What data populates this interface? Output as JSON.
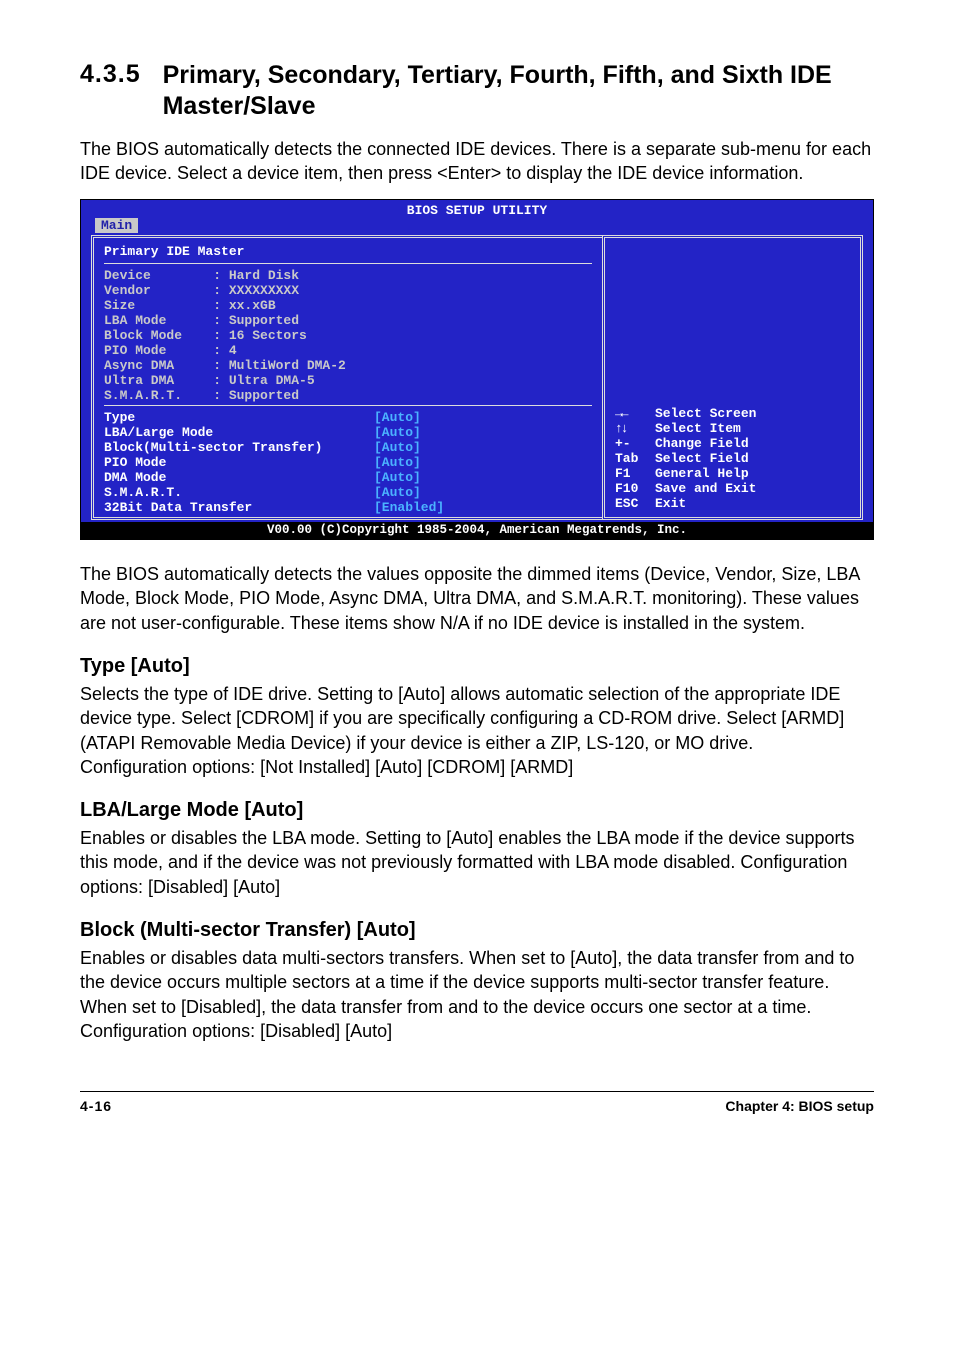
{
  "section": {
    "number": "4.3.5",
    "title": "Primary, Secondary, Tertiary, Fourth, Fifth, and Sixth IDE Master/Slave"
  },
  "intro": "The BIOS automatically detects the connected IDE devices. There is a separate sub-menu for each IDE device. Select a device item, then press <Enter> to display the IDE device information.",
  "bios": {
    "title": "BIOS SETUP UTILITY",
    "tab": "Main",
    "panel_head": "Primary IDE Master",
    "detected": [
      {
        "k": "Device",
        "v": "Hard Disk"
      },
      {
        "k": "Vendor",
        "v": "XXXXXXXXX"
      },
      {
        "k": "Size",
        "v": "xx.xGB"
      },
      {
        "k": "LBA Mode",
        "v": "Supported"
      },
      {
        "k": "Block Mode",
        "v": "16 Sectors"
      },
      {
        "k": "PIO Mode",
        "v": "4"
      },
      {
        "k": "Async DMA",
        "v": "MultiWord DMA-2"
      },
      {
        "k": "Ultra DMA",
        "v": "Ultra DMA-5"
      },
      {
        "k": "S.M.A.R.T.",
        "v": "Supported"
      }
    ],
    "config": [
      {
        "k": "Type",
        "v": "[Auto]"
      },
      {
        "k": "LBA/Large Mode",
        "v": "[Auto]"
      },
      {
        "k": "Block(Multi-sector Transfer)",
        "v": "[Auto]"
      },
      {
        "k": "PIO Mode",
        "v": "[Auto]"
      },
      {
        "k": "DMA Mode",
        "v": "[Auto]"
      },
      {
        "k": "S.M.A.R.T.",
        "v": "[Auto]"
      },
      {
        "k": "32Bit Data Transfer",
        "v": "[Enabled]"
      }
    ],
    "help": [
      {
        "key_icon": "lr",
        "key": "",
        "lbl": "Select Screen"
      },
      {
        "key_icon": "ud",
        "key": "",
        "lbl": "Select Item"
      },
      {
        "key": "+-",
        "lbl": "Change Field"
      },
      {
        "key": "Tab",
        "lbl": "Select Field"
      },
      {
        "key": "F1",
        "lbl": "General Help"
      },
      {
        "key": "F10",
        "lbl": "Save and Exit"
      },
      {
        "key": "ESC",
        "lbl": "Exit"
      }
    ],
    "footer": "V00.00 (C)Copyright 1985-2004, American Megatrends, Inc."
  },
  "post_bios_para": "The BIOS automatically detects the values opposite the dimmed items (Device, Vendor, Size, LBA Mode, Block Mode, PIO Mode, Async DMA, Ultra DMA, and S.M.A.R.T. monitoring). These values are not user-configurable. These items show N/A if no IDE device is installed in the system.",
  "subsections": [
    {
      "title": "Type [Auto]",
      "body": "Selects the type of IDE drive. Setting to [Auto] allows automatic selection of the appropriate IDE device type. Select [CDROM] if you are specifically configuring a CD-ROM drive. Select [ARMD] (ATAPI Removable Media Device) if your device is either a ZIP, LS-120, or MO drive.\nConfiguration options: [Not Installed] [Auto] [CDROM] [ARMD]"
    },
    {
      "title": "LBA/Large Mode [Auto]",
      "body": "Enables or disables the LBA mode. Setting to [Auto] enables the LBA mode if the device supports this mode, and if the device was not previously formatted with LBA mode disabled. Configuration options: [Disabled] [Auto]"
    },
    {
      "title": "Block (Multi-sector Transfer) [Auto]",
      "body": "Enables or disables data multi-sectors transfers. When set to [Auto], the data transfer from and to the device occurs multiple sectors at a time if the device supports multi-sector transfer feature. When set to [Disabled], the data transfer from and to the device occurs one sector at a time. Configuration options: [Disabled] [Auto]"
    }
  ],
  "footer": {
    "left": "4-16",
    "right": "Chapter 4: BIOS setup"
  }
}
